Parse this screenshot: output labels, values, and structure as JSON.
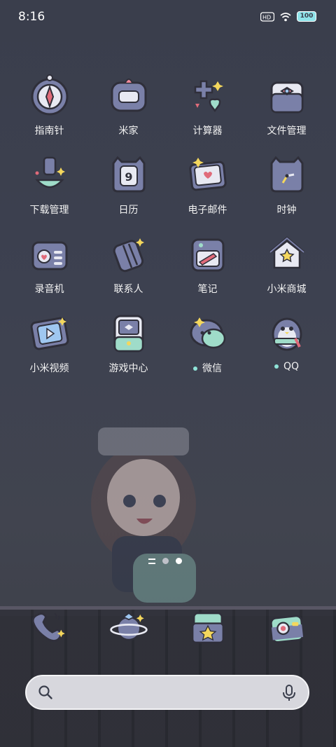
{
  "status": {
    "time": "8:16",
    "battery": "100"
  },
  "apps": [
    {
      "label": "指南针",
      "name": "app-compass"
    },
    {
      "label": "米家",
      "name": "app-mijia"
    },
    {
      "label": "计算器",
      "name": "app-calculator"
    },
    {
      "label": "文件管理",
      "name": "app-file-manager"
    },
    {
      "label": "下载管理",
      "name": "app-downloads"
    },
    {
      "label": "日历",
      "name": "app-calendar",
      "calendar_day": "9"
    },
    {
      "label": "电子邮件",
      "name": "app-email"
    },
    {
      "label": "时钟",
      "name": "app-clock"
    },
    {
      "label": "录音机",
      "name": "app-recorder"
    },
    {
      "label": "联系人",
      "name": "app-contacts"
    },
    {
      "label": "笔记",
      "name": "app-notes"
    },
    {
      "label": "小米商城",
      "name": "app-mi-store"
    },
    {
      "label": "小米视频",
      "name": "app-mi-video"
    },
    {
      "label": "游戏中心",
      "name": "app-game-center"
    },
    {
      "label": "微信",
      "name": "app-wechat",
      "has_dot": true
    },
    {
      "label": "QQ",
      "name": "app-qq",
      "has_dot": true
    }
  ],
  "dock": [
    {
      "name": "dock-phone",
      "icon": "phone-icon"
    },
    {
      "name": "dock-browser",
      "icon": "planet-icon"
    },
    {
      "name": "dock-gallery",
      "icon": "star-folder-icon"
    },
    {
      "name": "dock-camera",
      "icon": "camera-icon"
    }
  ],
  "colors": {
    "accent": "#8fe3d8",
    "icon_outline": "#2f2f3a",
    "icon_fill": "#7a80a8"
  }
}
